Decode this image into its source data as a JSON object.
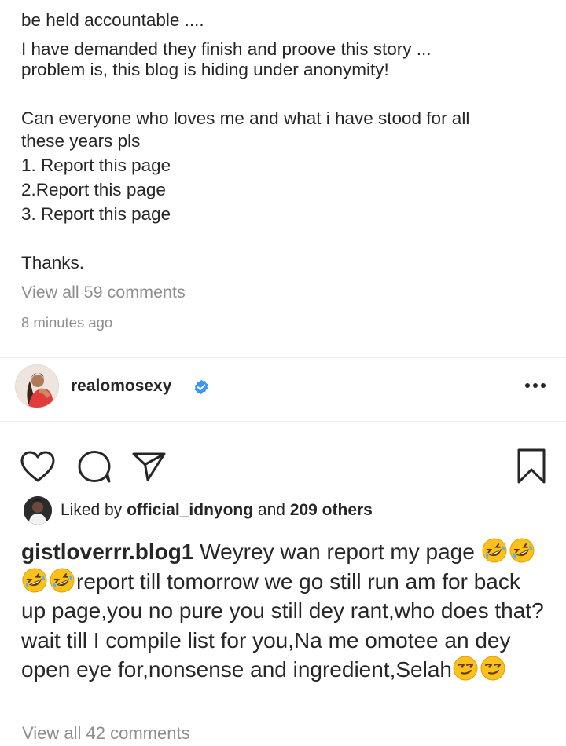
{
  "top_post": {
    "caption_lines": [
      "be held accountable ....",
      "I have demanded they finish and proove this story ...",
      "problem is, this blog is hiding under anonymity!",
      "",
      "Can everyone who loves me and what i have stood for all",
      "these years pls",
      "1. Report this page",
      "2.Report this page",
      "3. Report this page",
      "",
      "Thanks."
    ],
    "view_comments": "View all 59 comments",
    "timestamp": "8 minutes ago"
  },
  "post": {
    "username": "realomosexy",
    "verified": true,
    "more_icon": "more-horizontal-icon",
    "actions": {
      "like_icon": "heart-outline-icon",
      "comment_icon": "comment-bubble-icon",
      "share_icon": "paper-plane-icon",
      "save_icon": "bookmark-outline-icon"
    },
    "likes": {
      "prefix": "Liked by ",
      "liker": "official_idnyong",
      "middle": " and ",
      "others": "209 others"
    },
    "caption": {
      "username": "gistloverrr.blog1",
      "text_part1": " Weyrey wan report my page ",
      "laugh_emoji_count": 4,
      "text_part2": "report till tomorrow we go still run am for back up page,you no pure you still dey rant,who does that?wait till I compile list for you,Na me omotee an dey open eye for,nonsense and ingredient,Selah",
      "smirk_emoji_count": 2
    },
    "view_comments": "View all 42 comments"
  },
  "colors": {
    "text": "#262626",
    "secondary": "#8e8e8e",
    "verified_blue": "#3897f0",
    "divider": "#efefef"
  }
}
